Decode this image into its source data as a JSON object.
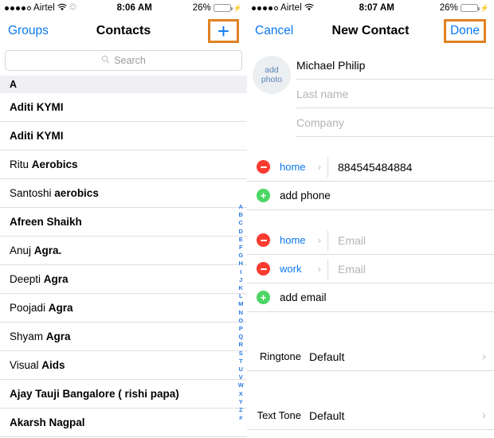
{
  "left": {
    "status": {
      "carrier": "Airtel",
      "time": "8:06 AM",
      "battery_pct": "26%",
      "signal_filled": 4,
      "signal_empty": 1,
      "wifi_icon": "wifi-icon",
      "activity_icon": "activity-spinner-icon",
      "battery_icon": "battery-icon",
      "charging_icon": "charging-bolt-icon",
      "battery_color": "#f6c915",
      "battery_level": 26
    },
    "nav": {
      "left_button": "Groups",
      "title": "Contacts",
      "add_icon": "plus-icon",
      "highlight_color": "#e08222"
    },
    "search": {
      "placeholder": "Search",
      "icon": "search-icon"
    },
    "section_header": "A",
    "contacts": [
      {
        "first": "Aditi",
        "last": "KYMI",
        "first_bold": true
      },
      {
        "first": "Aditi",
        "last": "KYMI",
        "first_bold": true
      },
      {
        "first": "Ritu",
        "last": "Aerobics",
        "first_bold": false
      },
      {
        "first": "Santoshi",
        "last": "aerobics",
        "first_bold": false
      },
      {
        "first": "Afreen",
        "last": "Shaikh",
        "first_bold": true
      },
      {
        "first": "Anuj",
        "last": "Agra.",
        "first_bold": false
      },
      {
        "first": "Deepti",
        "last": "Agra",
        "first_bold": false
      },
      {
        "first": "Poojadi",
        "last": "Agra",
        "first_bold": false
      },
      {
        "first": "Shyam",
        "last": "Agra",
        "first_bold": false
      },
      {
        "first": "Visual",
        "last": "Aids",
        "first_bold": false
      },
      {
        "first": "",
        "last": "Ajay Tauji Bangalore ( rishi papa)",
        "first_bold": true
      },
      {
        "first": "",
        "last": "Akarsh Nagpal",
        "first_bold": true
      }
    ],
    "index": [
      "A",
      "B",
      "C",
      "D",
      "E",
      "F",
      "G",
      "H",
      "I",
      "J",
      "K",
      "L",
      "M",
      "N",
      "O",
      "P",
      "Q",
      "R",
      "S",
      "T",
      "U",
      "V",
      "W",
      "X",
      "Y",
      "Z",
      "#"
    ]
  },
  "right": {
    "status": {
      "carrier": "Airtel",
      "time": "8:07 AM",
      "battery_pct": "26%",
      "signal_filled": 4,
      "signal_empty": 1,
      "wifi_icon": "wifi-icon",
      "battery_icon": "battery-icon",
      "charging_icon": "charging-bolt-icon",
      "battery_color": "#f6c915",
      "battery_level": 26
    },
    "nav": {
      "left_button": "Cancel",
      "title": "New Contact",
      "right_button": "Done",
      "highlight_color": "#e08222"
    },
    "photo": {
      "line1": "add",
      "line2": "photo"
    },
    "name": {
      "first_value": "Michael Philip",
      "last_placeholder": "Last name",
      "company_placeholder": "Company"
    },
    "phone": {
      "entries": [
        {
          "label": "home",
          "value": "884545484884",
          "placeholder": ""
        }
      ],
      "add_label": "add phone",
      "remove_icon": "minus-circle-icon",
      "add_icon": "plus-circle-icon",
      "chevron_icon": "chevron-right-icon"
    },
    "email": {
      "entries": [
        {
          "label": "home",
          "value": "",
          "placeholder": "Email"
        },
        {
          "label": "work",
          "value": "",
          "placeholder": "Email"
        }
      ],
      "add_label": "add email",
      "remove_icon": "minus-circle-icon",
      "add_icon": "plus-circle-icon",
      "chevron_icon": "chevron-right-icon"
    },
    "tones": [
      {
        "label": "Ringtone",
        "value": "Default",
        "chevron": "chevron-right-icon"
      },
      {
        "label": "Text Tone",
        "value": "Default",
        "chevron": "chevron-right-icon"
      }
    ]
  }
}
